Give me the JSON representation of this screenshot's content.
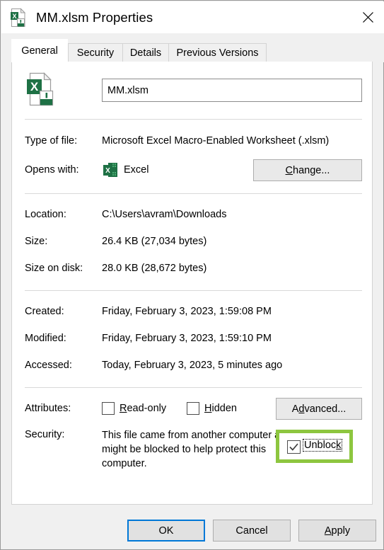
{
  "window": {
    "title": "MM.xlsm Properties",
    "title_icon": "excel-macro-file-icon",
    "close_icon": "close-icon"
  },
  "tabs": [
    {
      "label": "General",
      "active": true
    },
    {
      "label": "Security",
      "active": false
    },
    {
      "label": "Details",
      "active": false
    },
    {
      "label": "Previous Versions",
      "active": false
    }
  ],
  "general": {
    "file_icon": "excel-macro-file-icon",
    "filename": "MM.xlsm",
    "rows": [
      {
        "label": "Type of file:",
        "value": "Microsoft Excel Macro-Enabled Worksheet (.xlsm)"
      },
      {
        "label": "Opens with:",
        "value": "Excel"
      },
      {
        "label": "Location:",
        "value": "C:\\Users\\avram\\Downloads"
      },
      {
        "label": "Size:",
        "value": "26.4 KB (27,034 bytes)"
      },
      {
        "label": "Size on disk:",
        "value": "28.0 KB (28,672 bytes)"
      },
      {
        "label": "Created:",
        "value": "Friday, February 3, 2023, 1:59:08 PM"
      },
      {
        "label": "Modified:",
        "value": "Friday, February 3, 2023, 1:59:10 PM"
      },
      {
        "label": "Accessed:",
        "value": "Today, February 3, 2023, 5 minutes ago"
      },
      {
        "label": "Attributes:",
        "value": ""
      },
      {
        "label": "Security:",
        "value": ""
      }
    ],
    "opens_with": {
      "app_name": "Excel",
      "app_icon": "excel-app-icon",
      "change_button": {
        "accel": "C",
        "rest": "hange..."
      }
    },
    "attributes": {
      "readonly": {
        "accel": "R",
        "rest": "ead-only",
        "checked": false
      },
      "hidden": {
        "accel": "H",
        "rest": "idden",
        "checked": false
      },
      "advanced_button": {
        "pre": "A",
        "accel": "d",
        "rest": "vanced..."
      }
    },
    "security": {
      "message": "This file came from another computer and might be blocked to help protect this computer.",
      "unblock": {
        "pre": "Unbloc",
        "accel": "k",
        "checked": true,
        "highlight_color": "#8dc63f"
      }
    }
  },
  "footer": {
    "ok": "OK",
    "cancel": "Cancel",
    "apply": {
      "accel": "A",
      "rest": "pply"
    }
  },
  "colors": {
    "accent": "#0078d7",
    "excel_green": "#1e7145",
    "highlight_green": "#8dc63f",
    "dialog_bg": "#f0f0f0",
    "panel_bg": "#ffffff"
  }
}
